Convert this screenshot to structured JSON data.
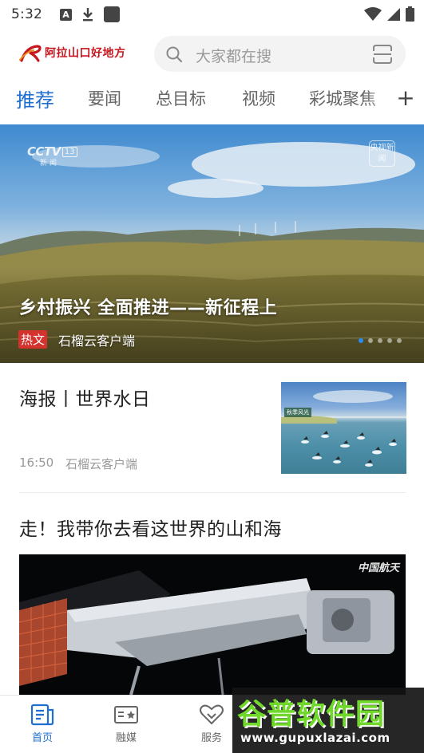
{
  "status_bar": {
    "time": "5:32",
    "a_icon": "A"
  },
  "header": {
    "logo_text": "阿拉山口好地方",
    "search_placeholder": "大家都在搜"
  },
  "tabs": {
    "items": [
      {
        "label": "推荐",
        "active": true
      },
      {
        "label": "要闻",
        "active": false
      },
      {
        "label": "总目标",
        "active": false
      },
      {
        "label": "视频",
        "active": false
      },
      {
        "label": "彩城聚焦",
        "active": false
      }
    ],
    "add_label": "+"
  },
  "banner": {
    "channel_logo": "CCTV",
    "channel_number": "13",
    "channel_sub": "新闻",
    "corner_badge": "央视新闻",
    "title": "乡村振兴 全面推进——新征程上",
    "tag": "热文",
    "source": "石榴云客户端",
    "dots_total": 5,
    "dots_active_index": 0
  },
  "news": [
    {
      "title": "海报丨世界水日",
      "time": "16:50",
      "source": "石榴云客户端",
      "thumb_caption": "秋季风光"
    },
    {
      "title": "走！我带你去看这世界的山和海",
      "media_logo": "中国航天"
    }
  ],
  "bottom_nav": {
    "items": [
      {
        "label": "首页",
        "icon": "home-doc-icon",
        "active": true
      },
      {
        "label": "融媒",
        "icon": "media-card-icon",
        "active": false
      },
      {
        "label": "服务",
        "icon": "heart-service-icon",
        "active": false
      }
    ]
  },
  "watermark": {
    "text": "谷普软件园",
    "url": "www.gupuxlazai.com"
  },
  "colors": {
    "accent": "#1e6fd0",
    "brand_red": "#c8161e",
    "tag_red": "#d4322c",
    "watermark_green": "#6fd82b"
  }
}
